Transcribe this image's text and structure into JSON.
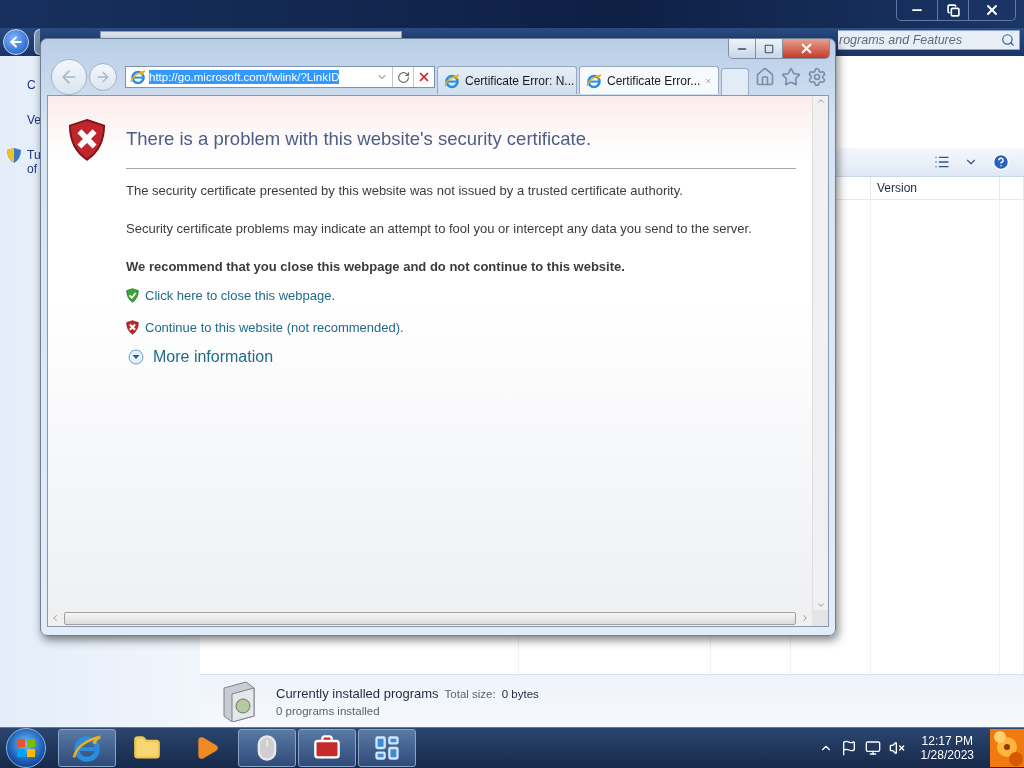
{
  "control_panel": {
    "search": {
      "placeholder": "rograms and Features"
    },
    "left_pane": [
      {
        "kind": "text",
        "label": "C"
      },
      {
        "kind": "text",
        "label": "Ve"
      },
      {
        "kind": "shield",
        "lines": [
          "Tu",
          "of"
        ]
      }
    ],
    "columns": [
      "Version"
    ],
    "details": {
      "title": "Currently installed programs",
      "size_label": "Total size:",
      "size_value": "0 bytes",
      "count": "0 programs installed"
    }
  },
  "browser": {
    "address": {
      "value": "http://go.microsoft.com/fwlink/?LinkID",
      "selected": true
    },
    "tabs": [
      {
        "label": "Certificate Error: N...",
        "selected": false
      },
      {
        "label": "Certificate Error...",
        "selected": true
      }
    ],
    "page": {
      "heading": "There is a problem with this website's security certificate.",
      "paragraphs": [
        "The security certificate presented by this website was not issued by a trusted certificate authority.",
        "Security certificate problems may indicate an attempt to fool you or intercept any data you send to the server."
      ],
      "recommendation": "We recommend that you close this webpage and do not continue to this website.",
      "links": [
        {
          "kind": "safe",
          "label": "Click here to close this webpage."
        },
        {
          "kind": "unsafe",
          "label": "Continue to this website (not recommended)."
        }
      ],
      "more_info": {
        "label": "More information",
        "expanded": false
      }
    }
  },
  "taskbar": {
    "items": [
      {
        "kind": "browser",
        "running": true
      },
      {
        "kind": "folder",
        "running": false
      },
      {
        "kind": "media",
        "running": false
      },
      {
        "kind": "mouse",
        "running": true
      },
      {
        "kind": "toolbox",
        "running": true
      },
      {
        "kind": "control_panel",
        "running": true
      }
    ],
    "time": "12:17 PM",
    "date": "1/28/2023"
  }
}
